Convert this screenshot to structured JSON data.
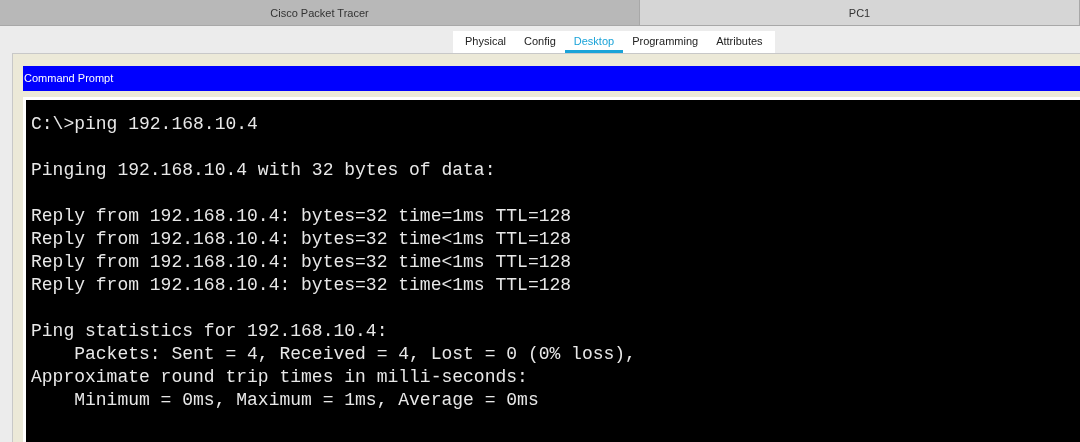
{
  "window_tabs": [
    {
      "label": "Cisco Packet Tracer",
      "selected": false
    },
    {
      "label": "PC1",
      "selected": true
    }
  ],
  "tabs": [
    {
      "label": "Physical",
      "selected": false
    },
    {
      "label": "Config",
      "selected": false
    },
    {
      "label": "Desktop",
      "selected": true
    },
    {
      "label": "Programming",
      "selected": false
    },
    {
      "label": "Attributes",
      "selected": false
    }
  ],
  "panel": {
    "title": "Command Prompt"
  },
  "terminal": {
    "blocks": [
      [
        "C:\\>ping 192.168.10.4"
      ],
      [
        "Pinging 192.168.10.4 with 32 bytes of data:"
      ],
      [
        "Reply from 192.168.10.4: bytes=32 time=1ms TTL=128",
        "Reply from 192.168.10.4: bytes=32 time<1ms TTL=128",
        "Reply from 192.168.10.4: bytes=32 time<1ms TTL=128",
        "Reply from 192.168.10.4: bytes=32 time<1ms TTL=128"
      ],
      [
        "Ping statistics for 192.168.10.4:",
        "    Packets: Sent = 4, Received = 4, Lost = 0 (0% loss),",
        "Approximate round trip times in milli-seconds:",
        "    Minimum = 0ms, Maximum = 1ms, Average = 0ms"
      ]
    ]
  }
}
